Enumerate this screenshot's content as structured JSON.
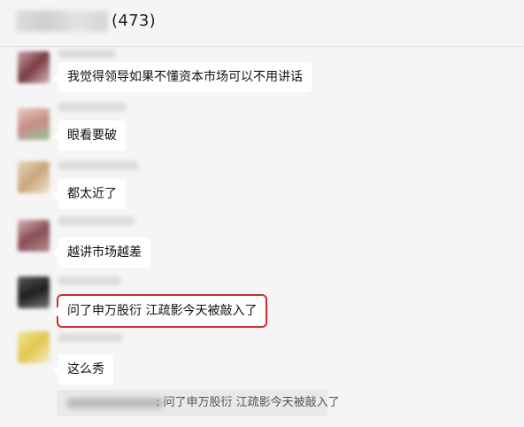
{
  "header": {
    "count": "(473)"
  },
  "messages": [
    {
      "text": "我觉得领导如果不懂资本市场可以不用讲话"
    },
    {
      "text": "眼看要破"
    },
    {
      "text": "都太近了"
    },
    {
      "text": "越讲市场越差"
    },
    {
      "text": "问了申万股衍 江疏影今天被敲入了",
      "highlighted": true
    },
    {
      "text": "这么秀"
    }
  ],
  "quote": {
    "text": ": 问了申万股衍 江疏影今天被敲入了"
  },
  "colors": {
    "highlight_border": "#c8302e",
    "background": "#f5f5f5",
    "bubble": "#ffffff"
  }
}
